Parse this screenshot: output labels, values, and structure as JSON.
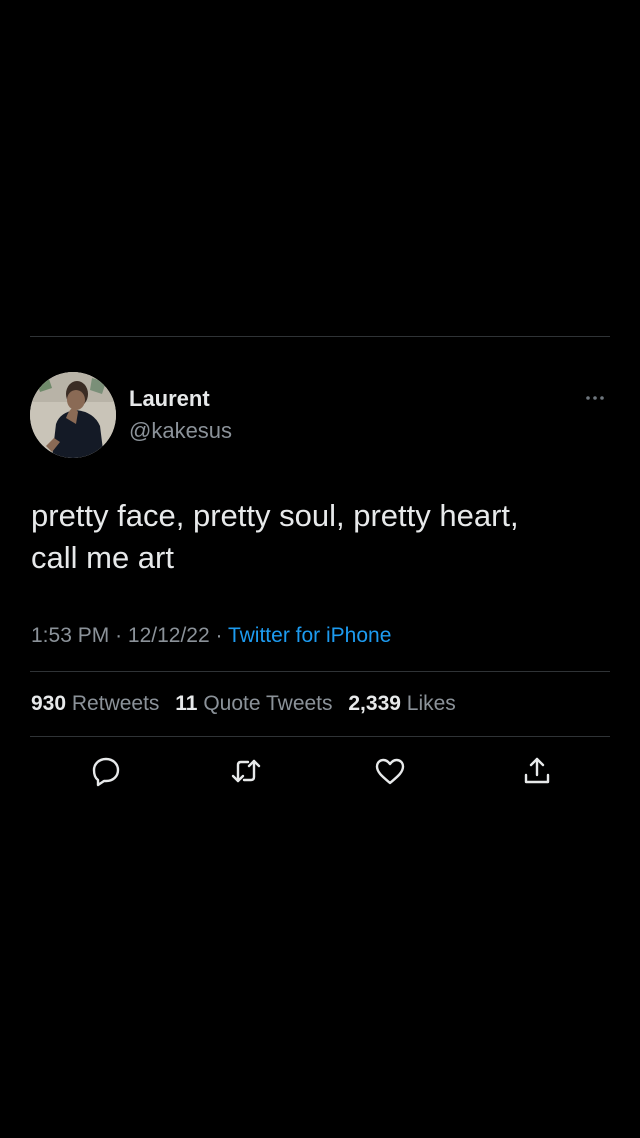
{
  "tweet": {
    "display_name": "Laurent",
    "handle": "@kakesus",
    "text_line1": "pretty face, pretty soul, pretty heart,",
    "text_line2": "call me art",
    "time": "1:53 PM",
    "separator": "·",
    "date": "12/12/22",
    "source": "Twitter for iPhone"
  },
  "stats": {
    "retweets_count": "930",
    "retweets_label": "Retweets",
    "quotes_count": "11",
    "quotes_label": "Quote Tweets",
    "likes_count": "2,339",
    "likes_label": "Likes"
  },
  "actions": {
    "icons": [
      "reply-icon",
      "retweet-icon",
      "like-icon",
      "share-icon"
    ]
  },
  "colors": {
    "background": "#000000",
    "primary_text": "#e7e9ea",
    "secondary_text": "#8b9299",
    "link": "#1d9bf0",
    "divider": "#2f3336"
  }
}
